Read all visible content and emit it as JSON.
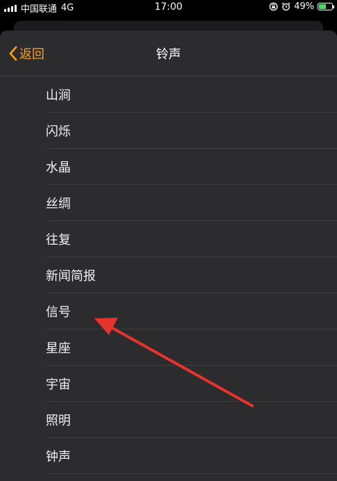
{
  "status_bar": {
    "carrier": "中国联通",
    "network": "4G",
    "time": "17:00",
    "battery_percent": "49%",
    "icons": [
      "signal-icon",
      "lock-rotation-icon",
      "alarm-icon",
      "battery-charging-icon"
    ]
  },
  "nav": {
    "back_label": "返回",
    "title": "铃声"
  },
  "ringtones": [
    "山涧",
    "闪烁",
    "水晶",
    "丝绸",
    "往复",
    "新闻简报",
    "信号",
    "星座",
    "宇宙",
    "照明",
    "钟声"
  ],
  "colors": {
    "accent": "#ff9f0a",
    "sheet_background": "#2c2c2e",
    "separator": "#3e3e41",
    "annotation_arrow": "#e8322c",
    "battery": "#4cd964"
  },
  "annotation": {
    "points_to": "信号"
  }
}
